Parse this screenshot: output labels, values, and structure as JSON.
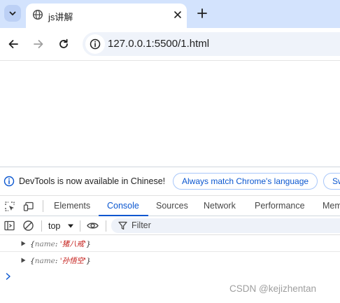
{
  "browser": {
    "tab": {
      "title": "js讲解"
    },
    "address": {
      "url": "127.0.0.1:5500/1.html"
    }
  },
  "devtools": {
    "infobar": {
      "message": "DevTools is now available in Chinese!",
      "match_language_label": "Always match Chrome's language",
      "switch_label": "Sw"
    },
    "tabs": [
      {
        "label": "Elements"
      },
      {
        "label": "Console"
      },
      {
        "label": "Sources"
      },
      {
        "label": "Network"
      },
      {
        "label": "Performance"
      },
      {
        "label": "Mem"
      }
    ],
    "active_tab": "Console",
    "console_toolbar": {
      "context": "top",
      "filter_placeholder": "Filter"
    },
    "console_entries": [
      {
        "open": "{",
        "key": "name",
        "colon": ": ",
        "value": "'猪八戒'",
        "close": "}"
      },
      {
        "open": "{",
        "key": "name",
        "colon": ": ",
        "value": "'孙悟空'",
        "close": "}"
      }
    ]
  },
  "watermark": "CSDN @kejizhentan",
  "colors": {
    "tab_strip": "#d3e3fd",
    "accent": "#0b57d0",
    "string_value": "#c41a16"
  }
}
